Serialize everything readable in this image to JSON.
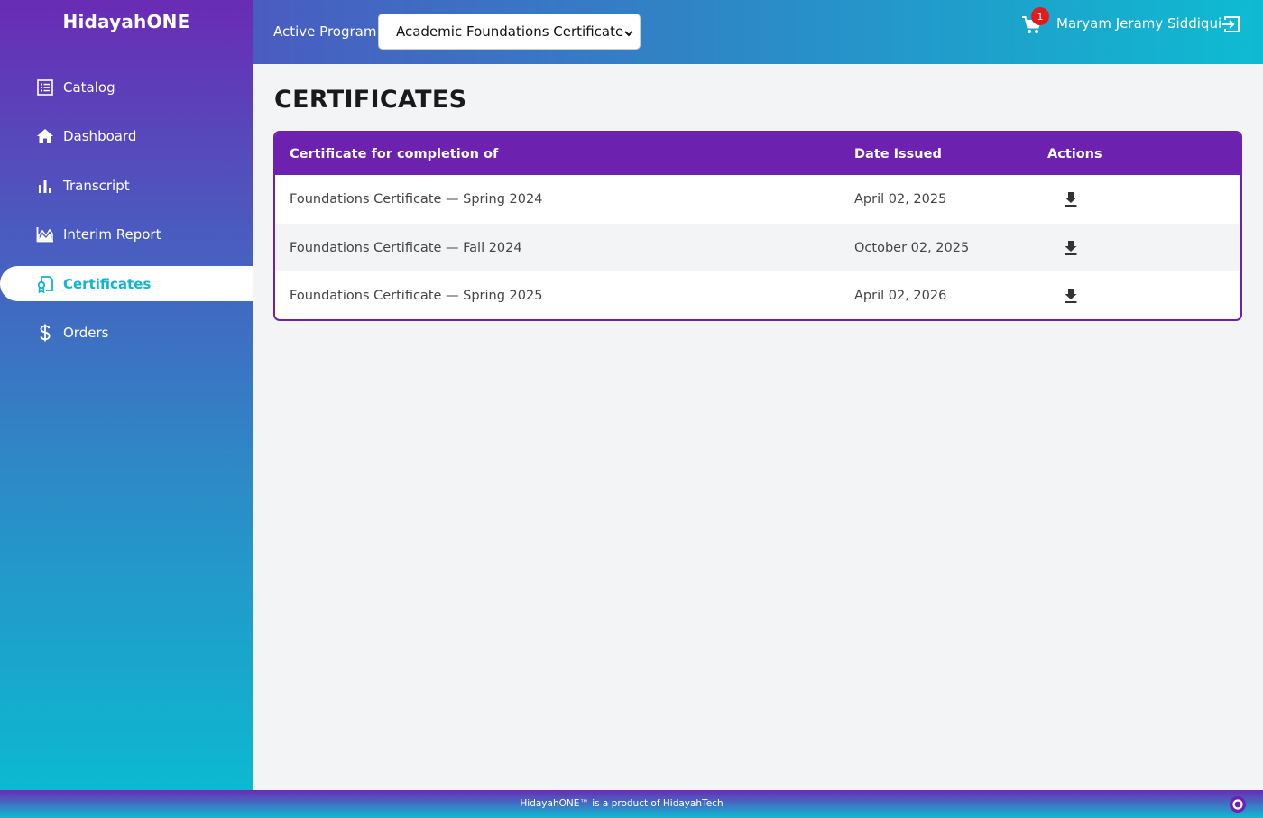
{
  "brand": {
    "name": "HidayahONE"
  },
  "sidebar": {
    "items": [
      {
        "label": "Catalog",
        "icon": "list-icon",
        "active": false
      },
      {
        "label": "Dashboard",
        "icon": "home-icon",
        "active": false
      },
      {
        "label": "Transcript",
        "icon": "bar-chart-icon",
        "active": false
      },
      {
        "label": "Interim Report",
        "icon": "area-chart-icon",
        "active": false
      },
      {
        "label": "Certificates",
        "icon": "certificate-icon",
        "active": true
      },
      {
        "label": "Orders",
        "icon": "dollar-icon",
        "active": false
      }
    ]
  },
  "header": {
    "active_program_label": "Active Program",
    "program_selected": "Academic Foundations Certificate",
    "cart_count": "1",
    "user_name": "Maryam Jeramy Siddiqui"
  },
  "main": {
    "title": "CERTIFICATES",
    "table": {
      "headers": [
        "Certificate for completion of",
        "Date Issued",
        "Actions"
      ],
      "rows": [
        {
          "name": "Foundations Certificate — Spring 2024",
          "date": "April 02, 2025"
        },
        {
          "name": "Foundations Certificate — Fall 2024",
          "date": "October 02, 2025"
        },
        {
          "name": "Foundations Certificate — Spring 2025",
          "date": "April 02, 2026"
        }
      ]
    }
  },
  "footer": {
    "text": "HidayahONE™ is a product of HidayahTech"
  },
  "colors": {
    "accent_purple": "#6c22ae",
    "accent_cyan": "#13b3cf",
    "badge_red": "#e31b1b"
  }
}
